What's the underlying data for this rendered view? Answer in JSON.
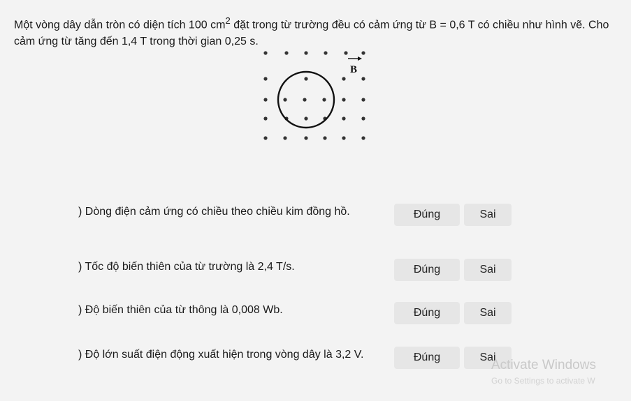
{
  "question": {
    "text_part1": "Một vòng dây dẫn tròn có diện tích 100 cm",
    "superscript": "2",
    "text_part2": " đặt trong từ trường đều có cảm ứng từ B = 0,6 T có chiều như hình vẽ. Cho cảm ứng từ tăng đến 1,4 T trong thời gian 0,25 s."
  },
  "figure": {
    "field_label": "B"
  },
  "statements": [
    {
      "text": ") Dòng điện cảm ứng có chiều theo chiều kim đồng hồ.",
      "true_label": "Đúng",
      "false_label": "Sai"
    },
    {
      "text": ") Tốc độ biến thiên của từ trường là 2,4 T/s.",
      "true_label": "Đúng",
      "false_label": "Sai"
    },
    {
      "text": ") Độ biến thiên của từ thông là 0,008 Wb.",
      "true_label": "Đúng",
      "false_label": "Sai"
    },
    {
      "text": ") Độ lớn suất điện động xuất hiện trong vòng dây là 3,2 V.",
      "true_label": "Đúng",
      "false_label": "Sai"
    }
  ],
  "watermark": {
    "title": "Activate Windows",
    "subtitle": "Go to Settings to activate W"
  }
}
